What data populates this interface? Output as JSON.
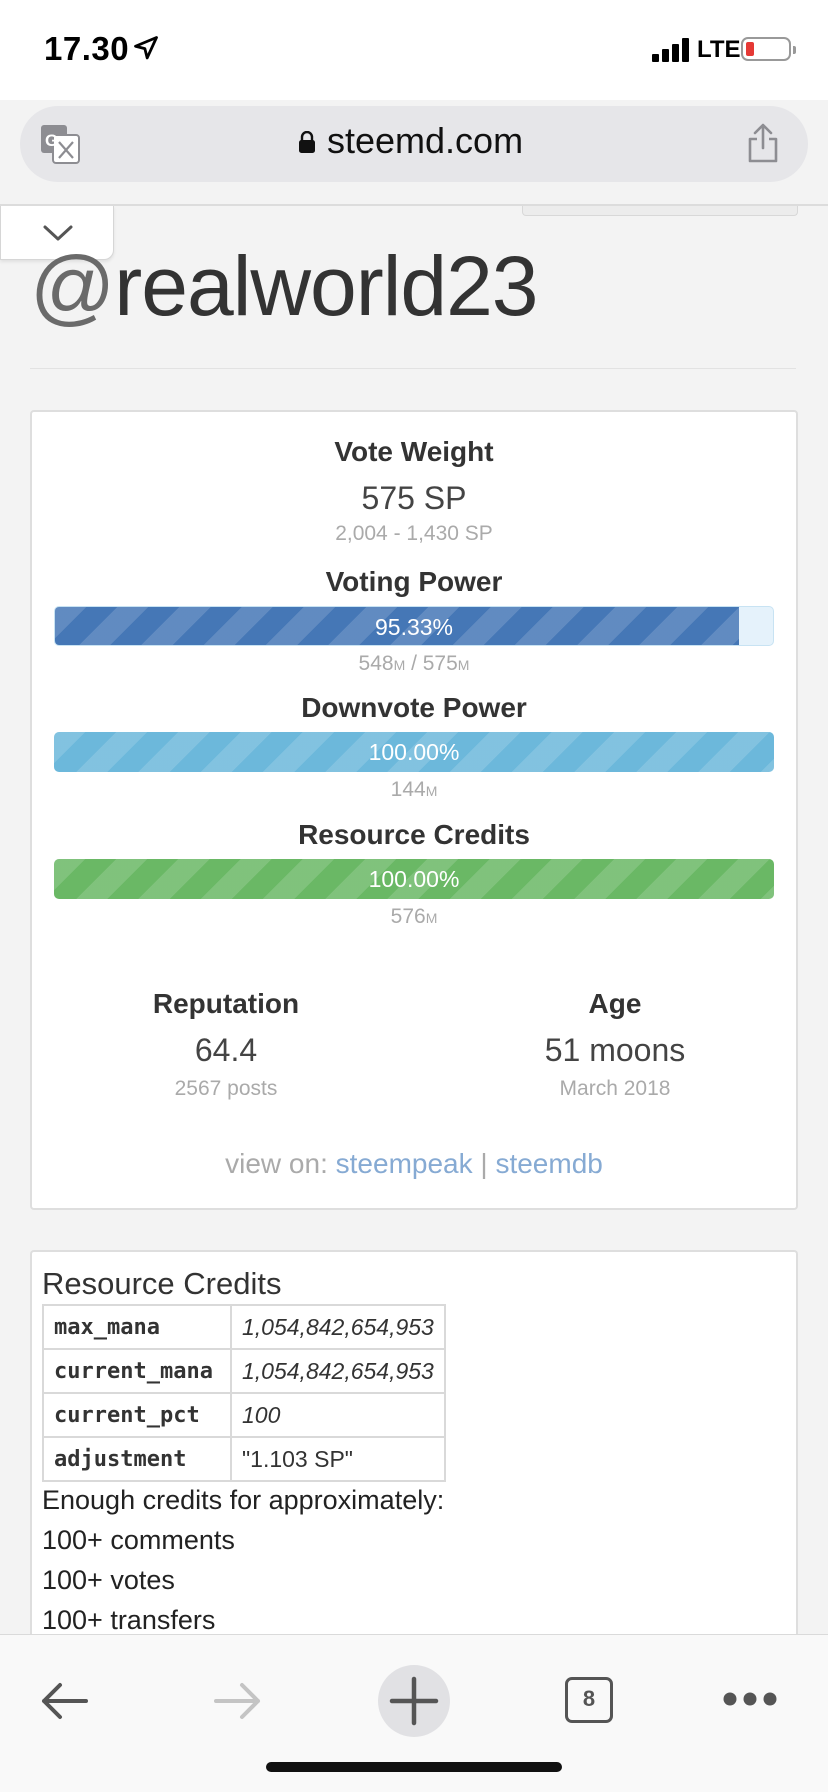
{
  "status_bar": {
    "time": "17.30",
    "network": "LTE",
    "battery_color": "#e53935"
  },
  "browser": {
    "url": "steemd.com"
  },
  "profile": {
    "at": "@",
    "username": "realworld23"
  },
  "vote_weight": {
    "title": "Vote Weight",
    "value": "575 SP",
    "range": "2,004 - 1,430 SP"
  },
  "voting_power": {
    "title": "Voting Power",
    "percent_label": "95.33%",
    "percent": 95.33,
    "current": "548",
    "max": "575",
    "unit": "M",
    "separator": " / "
  },
  "downvote_power": {
    "title": "Downvote Power",
    "percent_label": "100.00%",
    "percent": 100,
    "amount": "144",
    "unit": "M"
  },
  "resource_credits": {
    "title": "Resource Credits",
    "percent_label": "100.00%",
    "percent": 100,
    "amount": "576",
    "unit": "M"
  },
  "reputation": {
    "title": "Reputation",
    "value": "64.4",
    "sub": "2567 posts"
  },
  "age": {
    "title": "Age",
    "value": "51 moons",
    "sub": "March 2018"
  },
  "view_on": {
    "label": "view on:",
    "link1": "steempeak",
    "sep": "|",
    "link2": "steemdb"
  },
  "rc_detail": {
    "title": "Resource Credits",
    "rows": [
      {
        "key": "max_mana",
        "value": "1,054,842,654,953"
      },
      {
        "key": "current_mana",
        "value": "1,054,842,654,953"
      },
      {
        "key": "current_pct",
        "value": "100"
      },
      {
        "key": "adjustment",
        "value": "\"1.103 SP\""
      }
    ],
    "enough": "Enough credits for approximately:",
    "lines": [
      "100+ comments",
      "100+ votes",
      "100+ transfers"
    ]
  },
  "toolbar": {
    "tab_count": "8"
  },
  "colors": {
    "voting_bar": "#4577b6",
    "downvote_bar": "#6cb8db",
    "rc_bar": "#6ab865",
    "link": "#86aad3"
  }
}
